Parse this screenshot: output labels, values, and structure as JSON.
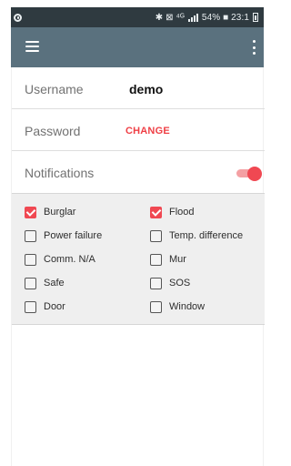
{
  "status_bar": {
    "right_text": "54% ■ 23:1",
    "symbols": "✱ ⊠ ⁴ᴳ"
  },
  "form": {
    "username": {
      "label": "Username",
      "value": "demo"
    },
    "password": {
      "label": "Password",
      "action": "CHANGE"
    },
    "notifications": {
      "label": "Notifications",
      "enabled": true
    }
  },
  "checkboxes": [
    {
      "label": "Burglar",
      "checked": true
    },
    {
      "label": "Flood",
      "checked": true
    },
    {
      "label": "Power failure",
      "checked": false
    },
    {
      "label": "Temp. difference",
      "checked": false
    },
    {
      "label": "Comm. N/A",
      "checked": false
    },
    {
      "label": "Mur",
      "checked": false
    },
    {
      "label": "Safe",
      "checked": false
    },
    {
      "label": "SOS",
      "checked": false
    },
    {
      "label": "Door",
      "checked": false
    },
    {
      "label": "Window",
      "checked": false
    }
  ],
  "colors": {
    "app_bar": "#5a717e",
    "status_bar": "#2f3a40",
    "accent": "#f04852",
    "toggle_track": "#f4a0a3"
  },
  "icons": {
    "menu": "hamburger-menu-icon",
    "overflow": "three-dots-vertical-icon",
    "status_app": "circle-status-icon",
    "bluetooth": "bluetooth-icon",
    "signal": "signal-icon",
    "battery": "battery-icon"
  }
}
